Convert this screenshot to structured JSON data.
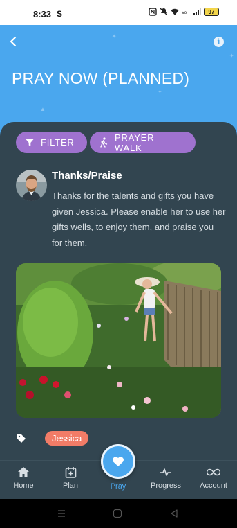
{
  "status_bar": {
    "time": "8:33",
    "carrier_glyph": "S",
    "battery": "97",
    "icons": [
      "nfc-icon",
      "mute-icon",
      "wifi-icon",
      "volte-icon",
      "signal-icon"
    ]
  },
  "header": {
    "title": "PRAY NOW (PLANNED)",
    "back_icon": "chevron-left-icon",
    "info_icon": "info-icon",
    "info_glyph": "i",
    "background": "#4aa7ee"
  },
  "filters": {
    "filter_label": "FILTER",
    "walk_label": "PRAYER WALK",
    "chip_color": "#9f72cf"
  },
  "post": {
    "title": "Thanks/Praise",
    "body": "Thanks for the talents and gifts you have given Jessica. Please enable her to use her gifts wells, to enjoy them, and praise you for them."
  },
  "tags": [
    {
      "label": "Jessica",
      "color": "#f27c67"
    }
  ],
  "nav": {
    "items": [
      {
        "label": "Home",
        "icon": "home-icon"
      },
      {
        "label": "Plan",
        "icon": "calendar-add-icon"
      },
      {
        "label": "Pray",
        "icon": "heart-icon",
        "active": true
      },
      {
        "label": "Progress",
        "icon": "pulse-icon"
      },
      {
        "label": "Account",
        "icon": "infinity-icon"
      }
    ],
    "active_color": "#4aa7ee"
  },
  "system_nav": [
    "recents-icon",
    "home-circle-icon",
    "back-triangle-icon"
  ]
}
